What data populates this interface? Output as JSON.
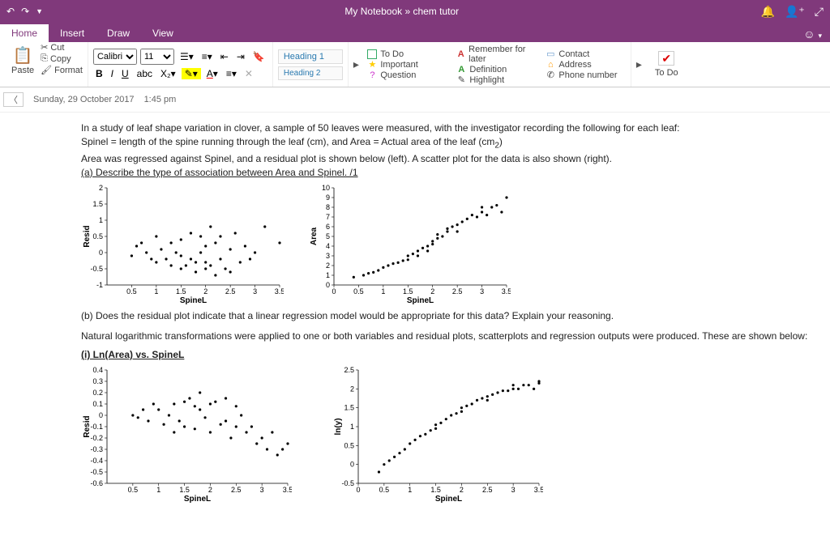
{
  "title": "My Notebook  »  chem tutor",
  "tabs": {
    "home": "Home",
    "insert": "Insert",
    "draw": "Draw",
    "view": "View"
  },
  "ribbon": {
    "paste": "Paste",
    "cut": "Cut",
    "copy": "Copy",
    "format": "Format",
    "font": "Calibri",
    "size": "11",
    "heading1": "Heading 1",
    "heading2": "Heading 2",
    "tags": {
      "todo": "To Do",
      "important": "Important",
      "question": "Question",
      "remember": "Remember for later",
      "definition": "Definition",
      "highlight": "Highlight",
      "contact": "Contact",
      "address": "Address",
      "phone": "Phone number"
    },
    "todo_btn": "To Do"
  },
  "date": "Sunday, 29 October 2017",
  "time": "1:45 pm",
  "content": {
    "p1": "In a study of leaf shape variation in clover, a sample of 50 leaves were measured, with the investigator recording the following for each leaf:",
    "p2a": "Spinel = length of the spine running through the leaf (cm), and Area = Actual area of the leaf (cm",
    "p2b": ")",
    "p3": "Area was regressed against Spinel, and a residual plot is shown below (left). A scatter plot for the data is also shown (right).",
    "qa": "(a) Describe the type of association between Area and Spinel. /1",
    "qb": "(b) Does the residual plot indicate that a linear regression model would be appropriate for this data? Explain your reasoning.",
    "p4": "Natural logarithmic transformations were applied to one or both variables and residual plots, scatterplots and regression outputs were produced. These are shown below:",
    "sub1": "(i) Ln(Area) vs. SpineL",
    "x": "SpineL",
    "y_resid": "Resid",
    "y_area": "Area",
    "y_lny": "ln(y)"
  },
  "chart_data": [
    {
      "type": "scatter",
      "title": "Residual plot",
      "xlabel": "SpineL",
      "ylabel": "Resid",
      "xlim": [
        0,
        3.5
      ],
      "xticks": [
        0.5,
        1,
        1.5,
        2,
        2.5,
        3,
        3.5
      ],
      "ylim": [
        -1,
        2
      ],
      "yticks": [
        -1,
        -0.5,
        0,
        0.5,
        1,
        1.5,
        2
      ],
      "points": [
        [
          0.5,
          -0.1
        ],
        [
          0.6,
          0.2
        ],
        [
          0.7,
          0.3
        ],
        [
          0.8,
          0.0
        ],
        [
          0.9,
          -0.2
        ],
        [
          1.0,
          0.5
        ],
        [
          1.0,
          -0.3
        ],
        [
          1.1,
          0.1
        ],
        [
          1.2,
          -0.2
        ],
        [
          1.3,
          -0.4
        ],
        [
          1.3,
          0.3
        ],
        [
          1.4,
          0.0
        ],
        [
          1.5,
          0.4
        ],
        [
          1.5,
          -0.1
        ],
        [
          1.5,
          -0.5
        ],
        [
          1.6,
          -0.4
        ],
        [
          1.7,
          0.6
        ],
        [
          1.7,
          -0.2
        ],
        [
          1.8,
          -0.3
        ],
        [
          1.8,
          -0.6
        ],
        [
          1.9,
          0.5
        ],
        [
          1.9,
          0.0
        ],
        [
          2.0,
          -0.3
        ],
        [
          2.0,
          -0.5
        ],
        [
          2.0,
          0.2
        ],
        [
          2.1,
          0.8
        ],
        [
          2.1,
          -0.4
        ],
        [
          2.2,
          0.3
        ],
        [
          2.2,
          -0.7
        ],
        [
          2.3,
          0.5
        ],
        [
          2.3,
          -0.2
        ],
        [
          2.4,
          -0.5
        ],
        [
          2.5,
          0.1
        ],
        [
          2.5,
          -0.6
        ],
        [
          2.6,
          0.6
        ],
        [
          2.7,
          -0.3
        ],
        [
          2.8,
          0.2
        ],
        [
          2.9,
          -0.2
        ],
        [
          3.0,
          0.0
        ],
        [
          3.2,
          0.8
        ],
        [
          3.5,
          0.3
        ]
      ]
    },
    {
      "type": "scatter",
      "title": "Area vs SpineL",
      "xlabel": "SpineL",
      "ylabel": "Area",
      "xlim": [
        0,
        3.5
      ],
      "xticks": [
        0,
        0.5,
        1,
        1.5,
        2,
        2.5,
        3,
        3.5
      ],
      "ylim": [
        0,
        10
      ],
      "yticks": [
        0,
        1,
        2,
        3,
        4,
        5,
        6,
        7,
        8,
        9,
        10
      ],
      "points": [
        [
          0.4,
          0.8
        ],
        [
          0.6,
          1.0
        ],
        [
          0.7,
          1.2
        ],
        [
          0.8,
          1.3
        ],
        [
          0.9,
          1.5
        ],
        [
          1.0,
          1.8
        ],
        [
          1.1,
          2.0
        ],
        [
          1.2,
          2.2
        ],
        [
          1.3,
          2.3
        ],
        [
          1.4,
          2.5
        ],
        [
          1.5,
          3.0
        ],
        [
          1.5,
          2.6
        ],
        [
          1.6,
          3.2
        ],
        [
          1.7,
          3.5
        ],
        [
          1.7,
          3.0
        ],
        [
          1.8,
          3.8
        ],
        [
          1.9,
          4.0
        ],
        [
          1.9,
          3.5
        ],
        [
          2.0,
          4.2
        ],
        [
          2.0,
          4.5
        ],
        [
          2.1,
          4.8
        ],
        [
          2.1,
          5.2
        ],
        [
          2.2,
          5.0
        ],
        [
          2.3,
          5.5
        ],
        [
          2.3,
          5.8
        ],
        [
          2.4,
          6.0
        ],
        [
          2.5,
          6.2
        ],
        [
          2.5,
          5.5
        ],
        [
          2.6,
          6.5
        ],
        [
          2.7,
          6.8
        ],
        [
          2.8,
          7.2
        ],
        [
          2.9,
          7.0
        ],
        [
          3.0,
          7.5
        ],
        [
          3.0,
          8.0
        ],
        [
          3.1,
          7.2
        ],
        [
          3.2,
          8.0
        ],
        [
          3.3,
          8.2
        ],
        [
          3.4,
          7.5
        ],
        [
          3.5,
          9.0
        ]
      ]
    },
    {
      "type": "scatter",
      "title": "Ln(Area) residual",
      "xlabel": "SpineL",
      "ylabel": "Resid",
      "xlim": [
        0,
        3.5
      ],
      "xticks": [
        0.5,
        1,
        1.5,
        2,
        2.5,
        3,
        3.5
      ],
      "ylim": [
        -0.6,
        0.4
      ],
      "yticks": [
        -0.6,
        -0.5,
        -0.4,
        -0.3,
        -0.2,
        -0.1,
        0,
        0.1,
        0.2,
        0.3,
        0.4
      ],
      "points": [
        [
          0.5,
          0.0
        ],
        [
          0.6,
          -0.02
        ],
        [
          0.7,
          0.05
        ],
        [
          0.8,
          -0.05
        ],
        [
          0.9,
          0.1
        ],
        [
          1.0,
          0.05
        ],
        [
          1.1,
          -0.08
        ],
        [
          1.2,
          0.0
        ],
        [
          1.3,
          0.1
        ],
        [
          1.3,
          -0.15
        ],
        [
          1.4,
          -0.05
        ],
        [
          1.5,
          0.12
        ],
        [
          1.5,
          -0.1
        ],
        [
          1.6,
          0.15
        ],
        [
          1.7,
          0.08
        ],
        [
          1.7,
          -0.12
        ],
        [
          1.8,
          0.05
        ],
        [
          1.8,
          0.2
        ],
        [
          1.9,
          -0.02
        ],
        [
          2.0,
          0.1
        ],
        [
          2.0,
          -0.15
        ],
        [
          2.1,
          0.12
        ],
        [
          2.2,
          -0.08
        ],
        [
          2.3,
          0.15
        ],
        [
          2.3,
          -0.05
        ],
        [
          2.4,
          -0.2
        ],
        [
          2.5,
          0.08
        ],
        [
          2.5,
          -0.1
        ],
        [
          2.6,
          0.0
        ],
        [
          2.7,
          -0.15
        ],
        [
          2.8,
          -0.1
        ],
        [
          2.9,
          -0.25
        ],
        [
          3.0,
          -0.2
        ],
        [
          3.1,
          -0.3
        ],
        [
          3.2,
          -0.15
        ],
        [
          3.3,
          -0.35
        ],
        [
          3.4,
          -0.3
        ],
        [
          3.5,
          -0.25
        ]
      ]
    },
    {
      "type": "scatter",
      "title": "ln(y) vs SpineL",
      "xlabel": "SpineL",
      "ylabel": "ln(y)",
      "xlim": [
        0,
        3.5
      ],
      "xticks": [
        0,
        0.5,
        1,
        1.5,
        2,
        2.5,
        3,
        3.5
      ],
      "ylim": [
        -0.5,
        2.5
      ],
      "yticks": [
        -0.5,
        0,
        0.5,
        1,
        1.5,
        2,
        2.5
      ],
      "points": [
        [
          0.4,
          -0.2
        ],
        [
          0.5,
          0.0
        ],
        [
          0.6,
          0.1
        ],
        [
          0.7,
          0.2
        ],
        [
          0.8,
          0.3
        ],
        [
          0.9,
          0.4
        ],
        [
          1.0,
          0.55
        ],
        [
          1.1,
          0.65
        ],
        [
          1.2,
          0.75
        ],
        [
          1.3,
          0.8
        ],
        [
          1.4,
          0.9
        ],
        [
          1.5,
          1.05
        ],
        [
          1.5,
          0.95
        ],
        [
          1.6,
          1.1
        ],
        [
          1.7,
          1.2
        ],
        [
          1.8,
          1.3
        ],
        [
          1.9,
          1.35
        ],
        [
          2.0,
          1.4
        ],
        [
          2.0,
          1.5
        ],
        [
          2.1,
          1.55
        ],
        [
          2.2,
          1.6
        ],
        [
          2.3,
          1.7
        ],
        [
          2.4,
          1.75
        ],
        [
          2.5,
          1.8
        ],
        [
          2.5,
          1.7
        ],
        [
          2.6,
          1.85
        ],
        [
          2.7,
          1.9
        ],
        [
          2.8,
          1.95
        ],
        [
          2.9,
          1.95
        ],
        [
          3.0,
          2.0
        ],
        [
          3.0,
          2.1
        ],
        [
          3.1,
          2.0
        ],
        [
          3.2,
          2.1
        ],
        [
          3.3,
          2.1
        ],
        [
          3.4,
          2.0
        ],
        [
          3.5,
          2.2
        ],
        [
          3.5,
          2.15
        ]
      ]
    }
  ]
}
